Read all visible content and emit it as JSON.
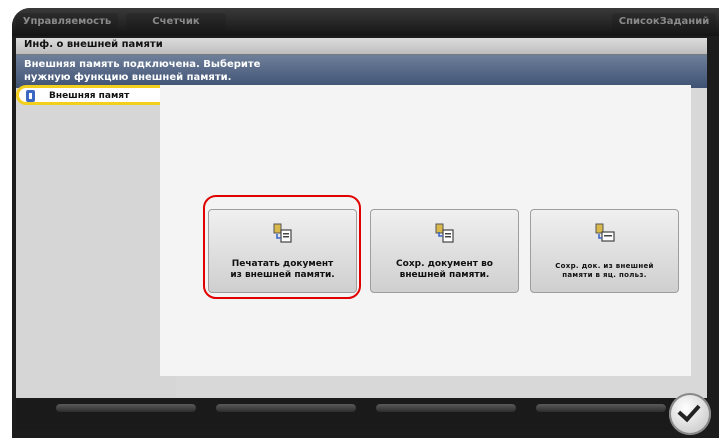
{
  "top_tabs": [
    "Управляемость",
    "Счетчик",
    "СписокЗаданий"
  ],
  "title": "Инф. о внешней памяти",
  "message": "Внешняя память подключена. Выберите\nнужную функцию внешней памяти.",
  "sidebar": {
    "tab_label": "Внешняя памят",
    "icon": "usb-memory-icon"
  },
  "buttons": [
    {
      "label": "Печатать документ\nиз внешней памяти.",
      "icon": "print-document-icon",
      "highlighted": true
    },
    {
      "label": "Сохр. документ во\nвнешней памяти.",
      "icon": "save-document-icon",
      "highlighted": false
    },
    {
      "label": "Сохр. док. из внешней\nпамяти в яц. польз.",
      "icon": "save-to-box-icon",
      "highlighted": false
    }
  ],
  "confirm": {
    "icon": "checkmark-icon"
  },
  "colors": {
    "highlight": "#e00000",
    "tab_outline": "#f1cf1c",
    "message_bar": "#4d5f80"
  }
}
